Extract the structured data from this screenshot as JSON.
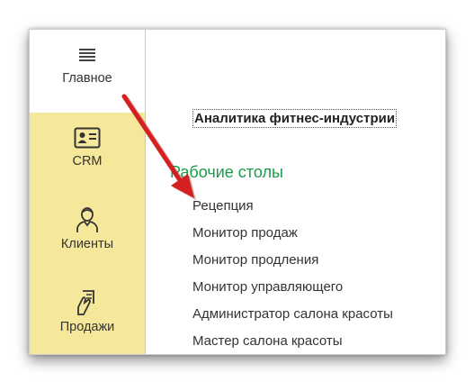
{
  "sidebar": {
    "items": [
      {
        "label": "Главное",
        "icon": "menu-lines-icon"
      },
      {
        "label": "CRM",
        "icon": "contact-card-icon"
      },
      {
        "label": "Клиенты",
        "icon": "person-icon"
      },
      {
        "label": "Продажи",
        "icon": "sales-hand-icon"
      }
    ]
  },
  "main": {
    "section_link": "Аналитика фитнес-индустрии",
    "group_title": "Рабочие столы",
    "items": [
      "Рецепция",
      "Монитор продаж",
      "Монитор продления",
      "Монитор управляющего",
      "Администратор салона красоты",
      "Мастер салона красоты"
    ]
  },
  "colors": {
    "sidebar_bg": "#f6e89a",
    "group_title": "#1a9c4a",
    "annotation_arrow": "#d42020"
  }
}
